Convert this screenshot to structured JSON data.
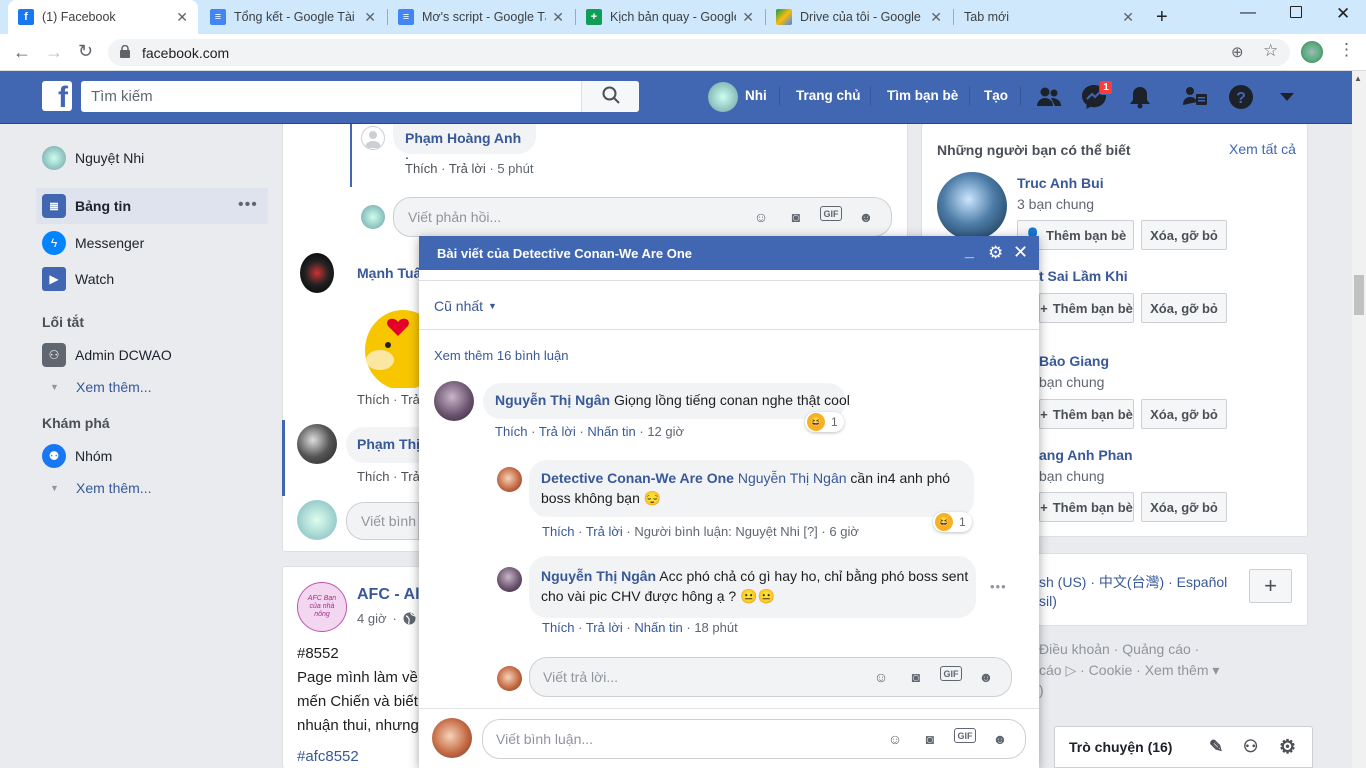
{
  "browser": {
    "tabs": [
      {
        "label": "(1) Facebook",
        "icon": "facebook-icon",
        "color": "#1877f2"
      },
      {
        "label": "Tổng kết - Google Tài liệ",
        "icon": "docs-icon",
        "color": "#4285f4"
      },
      {
        "label": "Mơ's script - Google Tài",
        "icon": "docs-icon",
        "color": "#4285f4"
      },
      {
        "label": "Kịch bản quay - Google",
        "icon": "sheets-icon",
        "color": "#0f9d58"
      },
      {
        "label": "Drive của tôi - Google D",
        "icon": "drive-icon",
        "color": "#fbbc04"
      },
      {
        "label": "Tab mới",
        "icon": "",
        "color": ""
      }
    ],
    "url": "facebook.com"
  },
  "header": {
    "search_placeholder": "Tìm kiếm",
    "profile_name": "Nhi",
    "nav": [
      "Trang chủ",
      "Tìm bạn bè",
      "Tạo"
    ],
    "messenger_badge": "1"
  },
  "left_nav": {
    "user": "Nguyệt Nhi",
    "items": [
      "Bảng tin",
      "Messenger",
      "Watch"
    ],
    "shortcuts_title": "Lối tắt",
    "shortcuts": [
      "Admin DCWAO"
    ],
    "see_more": "Xem thêm...",
    "explore_title": "Khám phá",
    "explore": [
      "Nhóm"
    ]
  },
  "feed": {
    "comment1_name": "Phạm Hoàng Anh",
    "comment1_suffix": ".",
    "comment1_like": "Thích",
    "comment1_reply": "Trả lời",
    "comment1_time": "5 phút",
    "reply_placeholder": "Viết phản hồi...",
    "comment2_name": "Mạnh Tuấn",
    "like": "Thích",
    "reply": "Trả",
    "comment3_name": "Phạm Thị",
    "comment_placeholder": "Viết bình l",
    "post_page": "AFC - All",
    "post_avatar_text": "AFC Bạn của nhà nông",
    "post_time": "4 giờ",
    "post_tag": "#8552",
    "post_lines": [
      "Page mình làm về T",
      "mến Chiến và biết t",
      "nhuận thui, nhưng l"
    ],
    "post_hashtag": "#afc8552"
  },
  "right": {
    "pymk_title": "Những người bạn có thể biết",
    "see_all": "Xem tất cả",
    "people": [
      {
        "name": "Truc Anh Bui",
        "mutual": "3 bạn chung"
      },
      {
        "name": "t Sai Lầm Khi",
        "mutual": ""
      },
      {
        "name": "Bảo Giang",
        "mutual": "bạn chung"
      },
      {
        "name": "ang Anh Phan",
        "mutual": "bạn chung"
      }
    ],
    "add_friend": "Thêm bạn bè",
    "remove": "Xóa, gỡ bỏ",
    "languages": "sh (US) · 中文(台灣) · Español",
    "languages2": "sil)",
    "footer1": "Điều khoản · Quảng cáo ·",
    "footer2": "cáo ▷ · Cookie · Xem thêm ▾",
    "footer3": ")",
    "chat_label": "Trò chuyện (16)"
  },
  "popup": {
    "title": "Bài viết của Detective Conan-We Are One",
    "sort": "Cũ nhất",
    "see_more": "Xem thêm 16 bình luận",
    "c1": {
      "name": "Nguyễn Thị Ngân",
      "text": "Giọng lồng tiếng conan nghe thật cool",
      "like": "Thích",
      "reply": "Trả lời",
      "translate": "Nhấn tin",
      "time": "12 giờ",
      "react_count": "1"
    },
    "r1": {
      "name": "Detective Conan-We Are One",
      "tag": "Nguyễn Thị Ngân",
      "text1": "cần in4 anh phó",
      "text2": "boss không bạn 😔",
      "like": "Thích",
      "reply": "Trả lời",
      "note": "Người bình luận: Nguyệt Nhi",
      "note_q": "[?]",
      "time": "6 giờ",
      "react_count": "1"
    },
    "r2": {
      "name": "Nguyễn Thị Ngân",
      "text1": "Acc phó chả có gì hay ho, chỉ bằng phó boss sent",
      "text2": "cho vài pic CHV được hông ạ ? 😐😐",
      "like": "Thích",
      "reply": "Trả lời",
      "translate": "Nhấn tin",
      "time": "18 phút"
    },
    "reply_placeholder": "Viết trả lời...",
    "comment_placeholder": "Viết bình luận..."
  }
}
